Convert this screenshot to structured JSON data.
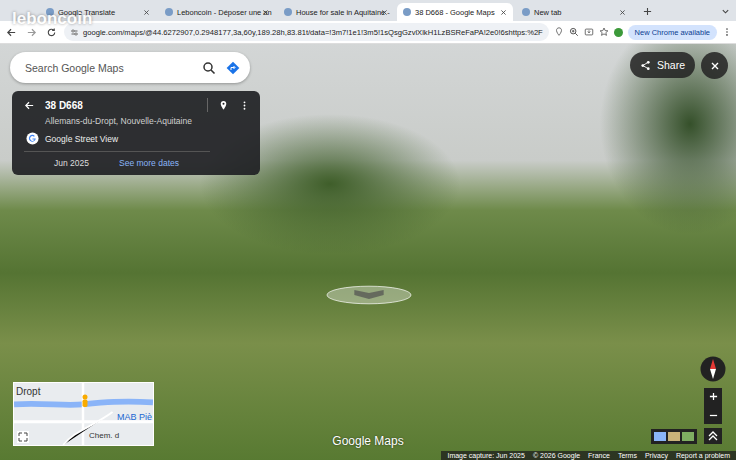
{
  "watermark": "leboncoin",
  "tabs": [
    {
      "label": "Google Translate",
      "selected": false
    },
    {
      "label": "Leboncoin - Déposer une an",
      "selected": false
    },
    {
      "label": "House for sale in Aquitaine -",
      "selected": false
    },
    {
      "label": "38 D668 - Google Maps",
      "selected": true
    },
    {
      "label": "New tab",
      "selected": false
    }
  ],
  "address_bar": {
    "url": "google.com/maps/@44.6272907,0.2948177,3a,60y,189.28h,83.81t/data=!3m7!1e1!3m5!1sQsgGzvlXlkH1LzBSReFaPA!2e0!6shttps:%2F"
  },
  "update_button": "New Chrome available",
  "search": {
    "placeholder": "Search Google Maps"
  },
  "share_button": "Share",
  "place_card": {
    "title": "38 D668",
    "subtitle": "Allemans-du-Dropt, Nouvelle-Aquitaine",
    "source": "Google Street View",
    "date": "Jun 2025",
    "more_dates": "See more dates"
  },
  "minimap": {
    "labels": [
      "Dropt",
      "MAB Piè",
      "Chem. d"
    ]
  },
  "logo": "Google Maps",
  "footer": [
    "Image capture: Jun 2025",
    "© 2026 Google",
    "France",
    "Terms",
    "Privacy",
    "Report a problem"
  ]
}
